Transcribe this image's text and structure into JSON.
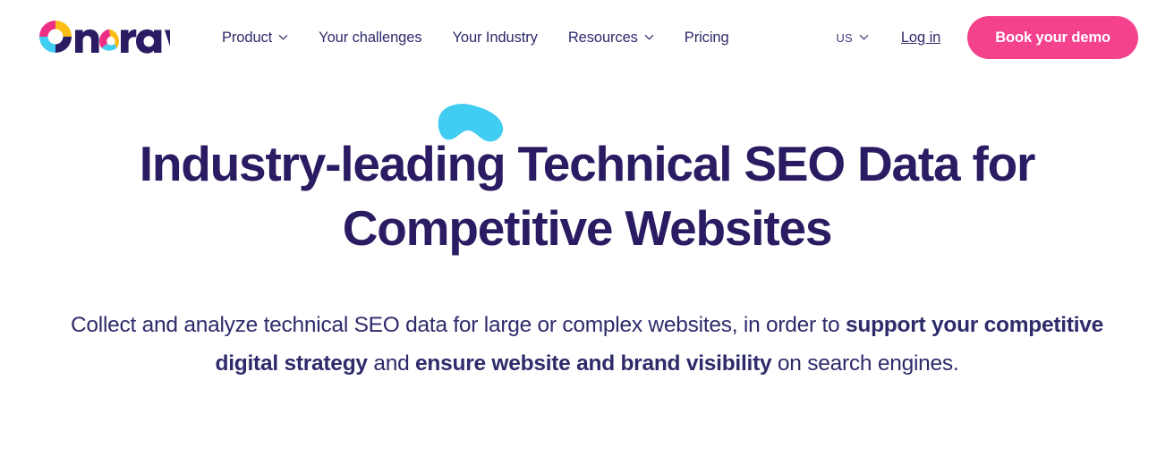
{
  "brand": {
    "name": "oncrawl",
    "colors": {
      "navy": "#2B1B62",
      "pink": "#F4428D",
      "cyan": "#41CCF2",
      "yellow": "#FBBC16",
      "text_navy": "#2E2B6B"
    }
  },
  "header": {
    "nav": [
      {
        "label": "Product",
        "has_dropdown": true,
        "icon": "chevron-down-icon"
      },
      {
        "label": "Your challenges",
        "has_dropdown": false,
        "icon": ""
      },
      {
        "label": "Your Industry",
        "has_dropdown": false,
        "icon": ""
      },
      {
        "label": "Resources",
        "has_dropdown": true,
        "icon": "chevron-down-icon"
      },
      {
        "label": "Pricing",
        "has_dropdown": false,
        "icon": ""
      }
    ],
    "locale": {
      "label": "US",
      "icon": "chevron-down-icon"
    },
    "login_label": "Log in",
    "cta_label": "Book your demo"
  },
  "hero": {
    "title_line1": "Industry-leading Technical SEO Data for",
    "title_line2": "Competitive Websites",
    "decoration": "cyan-swoosh-shape",
    "subtitle": {
      "part1": "Collect and analyze technical SEO data for large or complex websites, in order to ",
      "bold1": "support your competitive digital strategy",
      "part2": " and ",
      "bold2": "ensure website and brand visibility",
      "part3": " on search engines."
    }
  }
}
